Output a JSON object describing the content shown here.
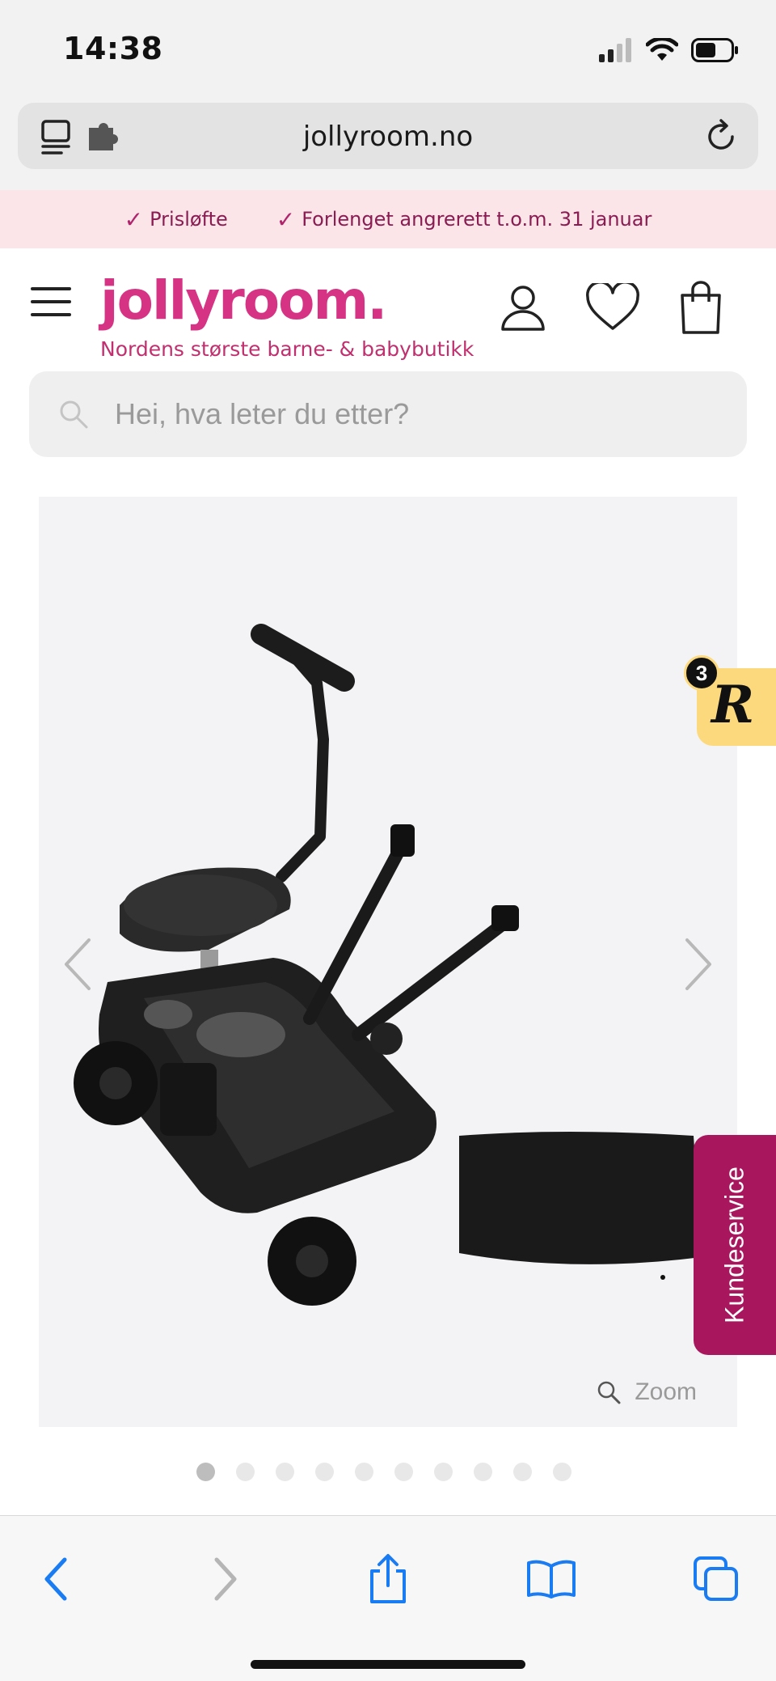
{
  "status_bar": {
    "time": "14:38"
  },
  "browser": {
    "url": "jollyroom.no"
  },
  "promo": {
    "items": [
      {
        "label": "Prisløfte"
      },
      {
        "label": "Forlenget angrerett t.o.m. 31 januar"
      }
    ]
  },
  "header": {
    "logo_text": "jollyroom.",
    "tagline": "Nordens største barne- & babybutikk"
  },
  "search": {
    "placeholder": "Hei, hva leter du etter?"
  },
  "gallery": {
    "zoom_label": "Zoom",
    "image_count": 10,
    "active_index": 0,
    "product_image_description": "ride-on board with seat",
    "product_tag": "Black"
  },
  "widgets": {
    "reward_count": "3",
    "reward_letter": "R",
    "customer_service_label": "Kundeservice"
  },
  "colors": {
    "brand_pink": "#d63384",
    "promo_bg": "#fbe5e9",
    "service_tab": "#a8175e",
    "reward_bg": "#fcd97c",
    "ios_blue": "#1a7cf2"
  }
}
